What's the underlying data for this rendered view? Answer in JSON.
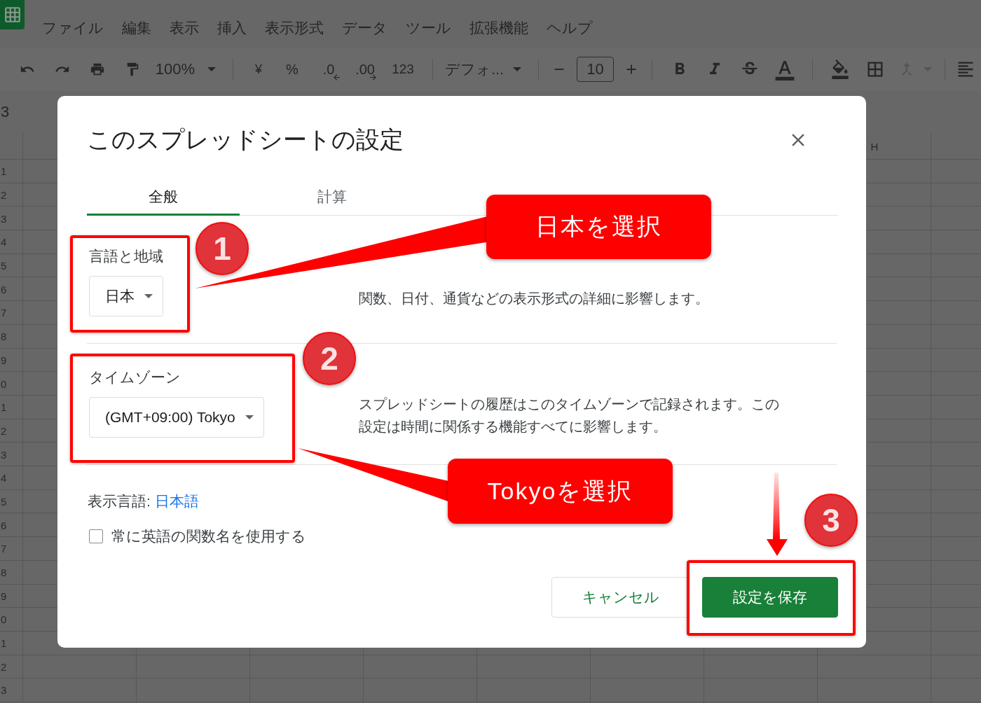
{
  "menu": [
    "ファイル",
    "編集",
    "表示",
    "挿入",
    "表示形式",
    "データ",
    "ツール",
    "拡張機能",
    "ヘルプ"
  ],
  "toolbar": {
    "zoom": "100%",
    "currency": "¥",
    "percent": "%",
    "decrease_decimals": ".0",
    "increase_decimals": ".00",
    "more_formats": "123",
    "font": "デフォ...",
    "font_size": "10"
  },
  "cell_reference": "3",
  "column_header": "H",
  "row_numbers": [
    "1",
    "2",
    "3",
    "4",
    "5",
    "6",
    "7",
    "8",
    "9",
    "0",
    "1",
    "2",
    "3",
    "4",
    "5",
    "6",
    "7",
    "8",
    "9",
    "0",
    "1",
    "2",
    "3"
  ],
  "dialog": {
    "title": "このスプレッドシートの設定",
    "tabs": [
      {
        "label": "全般",
        "selected": true
      },
      {
        "label": "計算",
        "selected": false
      }
    ],
    "sections": [
      {
        "label": "言語と地域",
        "value": "日本",
        "description": "関数、日付、通貨などの表示形式の詳細に影響します。"
      },
      {
        "label": "タイムゾーン",
        "value": "(GMT+09:00) Tokyo",
        "description": "スプレッドシートの履歴はこのタイムゾーンで記録されます。この設定は時間に関係する機能すべてに影響します。"
      }
    ],
    "display_language": {
      "label": "表示言語: ",
      "link": "日本語"
    },
    "checkbox": {
      "label": "常に英語の関数名を使用する",
      "checked": false
    },
    "buttons": {
      "cancel": "キャンセル",
      "save": "設定を保存"
    }
  },
  "annotations": {
    "steps": [
      "1",
      "2",
      "3"
    ],
    "callouts": [
      "日本を選択",
      "Tokyoを選択"
    ]
  }
}
